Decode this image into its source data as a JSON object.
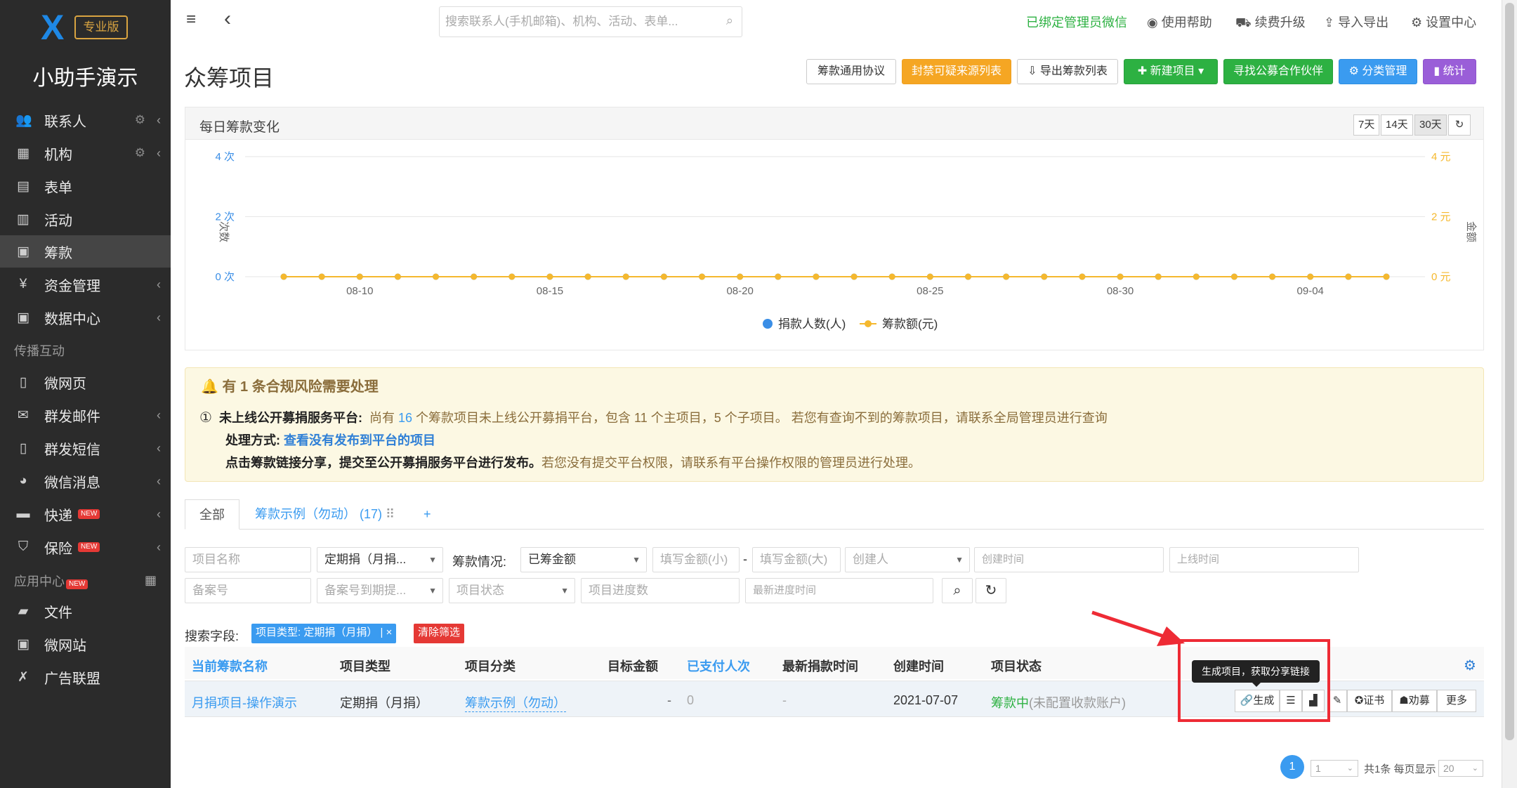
{
  "app": {
    "edition": "专业版",
    "name": "小助手演示"
  },
  "sidebar": {
    "items": [
      {
        "label": "联系人",
        "icon": "users-icon"
      },
      {
        "label": "机构",
        "icon": "building-icon"
      },
      {
        "label": "表单",
        "icon": "clipboard-icon"
      },
      {
        "label": "活动",
        "icon": "calendar-icon"
      },
      {
        "label": "筹款",
        "icon": "wallet-icon"
      },
      {
        "label": "资金管理",
        "icon": "yen-icon"
      },
      {
        "label": "数据中心",
        "icon": "database-icon"
      },
      {
        "label": "微网页",
        "icon": "file-icon"
      },
      {
        "label": "群发邮件",
        "icon": "mail-icon"
      },
      {
        "label": "群发短信",
        "icon": "mobile-icon"
      },
      {
        "label": "微信消息",
        "icon": "wechat-icon"
      },
      {
        "label": "快递",
        "icon": "truck-icon"
      },
      {
        "label": "保险",
        "icon": "shield-icon"
      },
      {
        "label": "文件",
        "icon": "folder-icon"
      },
      {
        "label": "微网站",
        "icon": "site-icon"
      },
      {
        "label": "广告联盟",
        "icon": "ad-icon"
      }
    ],
    "section_spread": "传播互动",
    "section_apps": "应用中心",
    "new_badge": "NEW"
  },
  "topbar": {
    "search_placeholder": "搜索联系人(手机邮箱)、机构、活动、表单...",
    "wechat_bound": "已绑定管理员微信",
    "help": "使用帮助",
    "upgrade": "续费升级",
    "import_export": "导入导出",
    "settings": "设置中心"
  },
  "page": {
    "title": "众筹项目"
  },
  "toolbar": {
    "agreement": "筹款通用协议",
    "block_sources": "封禁可疑来源列表",
    "export_list": "导出筹款列表",
    "new_project": "新建项目",
    "find_partner": "寻找公募合作伙伴",
    "category_mgmt": "分类管理",
    "stats": "统计"
  },
  "chart": {
    "panel_title": "每日筹款变化",
    "ranges": [
      "7天",
      "14天",
      "30天"
    ],
    "legend_donors": "捐款人数(人)",
    "legend_amount": "筹款额(元)"
  },
  "chart_data": {
    "type": "line",
    "x": [
      "08-08",
      "08-09",
      "08-10",
      "08-11",
      "08-12",
      "08-13",
      "08-14",
      "08-15",
      "08-16",
      "08-17",
      "08-18",
      "08-19",
      "08-20",
      "08-21",
      "08-22",
      "08-23",
      "08-24",
      "08-25",
      "08-26",
      "08-27",
      "08-28",
      "08-29",
      "08-30",
      "08-31",
      "09-01",
      "09-02",
      "09-03",
      "09-04",
      "09-05",
      "09-06"
    ],
    "xticks": [
      "08-10",
      "08-15",
      "08-20",
      "08-25",
      "08-30",
      "09-04"
    ],
    "series": [
      {
        "name": "捐款人数(人)",
        "color": "#3a8ee6",
        "values": [
          0,
          0,
          0,
          0,
          0,
          0,
          0,
          0,
          0,
          0,
          0,
          0,
          0,
          0,
          0,
          0,
          0,
          0,
          0,
          0,
          0,
          0,
          0,
          0,
          0,
          0,
          0,
          0,
          0,
          0
        ]
      },
      {
        "name": "筹款额(元)",
        "color": "#f5b82e",
        "values": [
          0,
          0,
          0,
          0,
          0,
          0,
          0,
          0,
          0,
          0,
          0,
          0,
          0,
          0,
          0,
          0,
          0,
          0,
          0,
          0,
          0,
          0,
          0,
          0,
          0,
          0,
          0,
          0,
          0,
          0
        ]
      }
    ],
    "yleft": {
      "label": "次数",
      "ticks": [
        "0 次",
        "2 次",
        "4 次"
      ],
      "range": [
        0,
        4
      ]
    },
    "yright": {
      "label": "金额",
      "ticks": [
        "0 元",
        "2 元",
        "4 元"
      ],
      "range": [
        0,
        4
      ]
    },
    "grid": true,
    "legend": "bottom"
  },
  "alert": {
    "title": "有 1 条合规风险需要处理",
    "num": "①",
    "item_label": "未上线公开募捐服务平台:",
    "item_text_a": "尚有",
    "item_count": "16",
    "item_text_b": "个筹款项目未上线公开募捐平台，包含 11 个主项目，5 个子项目。 若您有查询不到的筹款项目，请联系全局管理员进行查询",
    "method_label": "处理方式:",
    "method_link": "查看没有发布到平台的项目",
    "share_bold": "点击筹款链接分享，提交至公开募捐服务平台进行发布。",
    "share_text": "若您没有提交平台权限，请联系有平台操作权限的管理员进行处理。"
  },
  "tabs": {
    "all": "全部",
    "example": "筹款示例（勿动）",
    "example_count": "(17)",
    "add": "+"
  },
  "filters": {
    "project_name": "项目名称",
    "project_type": "定期捐（月捐...",
    "status_label": "筹款情况:",
    "raised": "已筹金额",
    "min": "填写金额(小)",
    "dash": "-",
    "max": "填写金额(大)",
    "creator": "创建人",
    "created_time": "创建时间",
    "online_time": "上线时间",
    "record_no": "备案号",
    "record_exp": "备案号到期提...",
    "project_status": "项目状态",
    "progress_count": "项目进度数",
    "latest_progress": "最新进度时间"
  },
  "search_fields": {
    "label": "搜索字段:",
    "chip": "项目类型: 定期捐（月捐）",
    "chip_close": "×",
    "clear": "清除筛选"
  },
  "table": {
    "headers": [
      "当前筹款名称",
      "项目类型",
      "项目分类",
      "目标金额",
      "已支付人次",
      "最新捐款时间",
      "创建时间",
      "项目状态"
    ],
    "row": {
      "name": "月捐项目-操作演示",
      "type": "定期捐（月捐）",
      "category": "筹款示例（勿动）",
      "target": "-",
      "paid": "0",
      "latest": "-",
      "created": "2021-07-07",
      "status": "筹款中",
      "status_note": "(未配置收款账户)"
    },
    "tooltip": "生成项目，获取分享链接",
    "actions": {
      "generate": "生成",
      "cert": "证书",
      "recruit": "劝募",
      "more": "更多"
    }
  },
  "pager": {
    "current": "1",
    "page_select": "1",
    "summary": "共1条 每页显示",
    "per_page": "20"
  }
}
